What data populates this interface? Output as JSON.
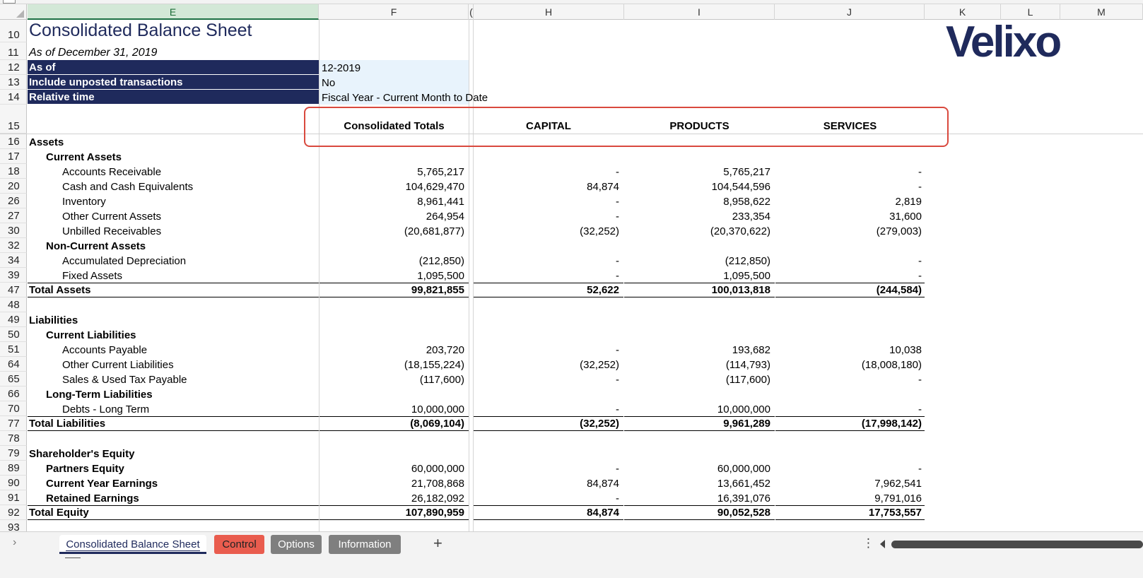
{
  "columns": [
    {
      "id": "E",
      "label": "E"
    },
    {
      "id": "F",
      "label": "F"
    },
    {
      "id": "G",
      "label": "("
    },
    {
      "id": "H",
      "label": "H"
    },
    {
      "id": "I",
      "label": "I"
    },
    {
      "id": "J",
      "label": "J"
    },
    {
      "id": "K",
      "label": "K"
    },
    {
      "id": "L",
      "label": "L"
    },
    {
      "id": "M",
      "label": "M"
    }
  ],
  "logo": "Velixo",
  "report": {
    "title": "Consolidated Balance Sheet",
    "subtitle": "As of December 31, 2019"
  },
  "params": [
    {
      "row": "12",
      "label": "As of",
      "value": "12-2019"
    },
    {
      "row": "13",
      "label": "Include unposted transactions",
      "value": "No"
    },
    {
      "row": "14",
      "label": "Relative time",
      "value": "Fiscal Year - Current Month to Date"
    }
  ],
  "header": {
    "row": "15",
    "consolidated": "Consolidated Totals",
    "capital": "CAPITAL",
    "products": "PRODUCTS",
    "services": "SERVICES"
  },
  "rows": [
    {
      "row": "16",
      "label": "Assets",
      "level": 0,
      "bold": true,
      "total": false,
      "f": "",
      "h": "",
      "i": "",
      "j": ""
    },
    {
      "row": "17",
      "label": "Current Assets",
      "level": 1,
      "bold": true,
      "total": false,
      "f": "",
      "h": "",
      "i": "",
      "j": ""
    },
    {
      "row": "18",
      "label": "Accounts Receivable",
      "level": 2,
      "bold": false,
      "total": false,
      "f": "5,765,217",
      "h": "-",
      "i": "5,765,217",
      "j": "-"
    },
    {
      "row": "20",
      "label": "Cash and Cash Equivalents",
      "level": 2,
      "bold": false,
      "total": false,
      "f": "104,629,470",
      "h": "84,874",
      "i": "104,544,596",
      "j": "-"
    },
    {
      "row": "26",
      "label": "Inventory",
      "level": 2,
      "bold": false,
      "total": false,
      "f": "8,961,441",
      "h": "-",
      "i": "8,958,622",
      "j": "2,819"
    },
    {
      "row": "27",
      "label": "Other Current Assets",
      "level": 2,
      "bold": false,
      "total": false,
      "f": "264,954",
      "h": "-",
      "i": "233,354",
      "j": "31,600"
    },
    {
      "row": "30",
      "label": "Unbilled Receivables",
      "level": 2,
      "bold": false,
      "total": false,
      "f": "(20,681,877)",
      "h": "(32,252)",
      "i": "(20,370,622)",
      "j": "(279,003)"
    },
    {
      "row": "32",
      "label": "Non-Current Assets",
      "level": 1,
      "bold": true,
      "total": false,
      "f": "",
      "h": "",
      "i": "",
      "j": ""
    },
    {
      "row": "34",
      "label": "Accumulated Depreciation",
      "level": 2,
      "bold": false,
      "total": false,
      "f": "(212,850)",
      "h": "-",
      "i": "(212,850)",
      "j": "-"
    },
    {
      "row": "39",
      "label": "Fixed Assets",
      "level": 2,
      "bold": false,
      "total": false,
      "f": "1,095,500",
      "h": "-",
      "i": "1,095,500",
      "j": "-"
    },
    {
      "row": "47",
      "label": "Total Assets",
      "level": 0,
      "bold": true,
      "total": true,
      "f": "99,821,855",
      "h": "52,622",
      "i": "100,013,818",
      "j": "(244,584)"
    },
    {
      "row": "48",
      "label": "",
      "level": 0,
      "bold": false,
      "total": false,
      "f": "",
      "h": "",
      "i": "",
      "j": ""
    },
    {
      "row": "49",
      "label": "Liabilities",
      "level": 0,
      "bold": true,
      "total": false,
      "f": "",
      "h": "",
      "i": "",
      "j": ""
    },
    {
      "row": "50",
      "label": "Current Liabilities",
      "level": 1,
      "bold": true,
      "total": false,
      "f": "",
      "h": "",
      "i": "",
      "j": ""
    },
    {
      "row": "51",
      "label": "Accounts Payable",
      "level": 2,
      "bold": false,
      "total": false,
      "f": "203,720",
      "h": "-",
      "i": "193,682",
      "j": "10,038"
    },
    {
      "row": "64",
      "label": "Other Current Liabilities",
      "level": 2,
      "bold": false,
      "total": false,
      "f": "(18,155,224)",
      "h": "(32,252)",
      "i": "(114,793)",
      "j": "(18,008,180)"
    },
    {
      "row": "65",
      "label": "Sales & Used Tax Payable",
      "level": 2,
      "bold": false,
      "total": false,
      "f": "(117,600)",
      "h": "-",
      "i": "(117,600)",
      "j": "-"
    },
    {
      "row": "66",
      "label": "Long-Term Liabilities",
      "level": 1,
      "bold": true,
      "total": false,
      "f": "",
      "h": "",
      "i": "",
      "j": ""
    },
    {
      "row": "70",
      "label": "Debts - Long Term",
      "level": 2,
      "bold": false,
      "total": false,
      "f": "10,000,000",
      "h": "-",
      "i": "10,000,000",
      "j": "-"
    },
    {
      "row": "77",
      "label": "Total Liabilities",
      "level": 0,
      "bold": true,
      "total": true,
      "f": "(8,069,104)",
      "h": "(32,252)",
      "i": "9,961,289",
      "j": "(17,998,142)"
    },
    {
      "row": "78",
      "label": "",
      "level": 0,
      "bold": false,
      "total": false,
      "f": "",
      "h": "",
      "i": "",
      "j": ""
    },
    {
      "row": "79",
      "label": "Shareholder's Equity",
      "level": 0,
      "bold": true,
      "total": false,
      "f": "",
      "h": "",
      "i": "",
      "j": ""
    },
    {
      "row": "89",
      "label": "Partners Equity",
      "level": 1,
      "bold": true,
      "total": false,
      "f": "60,000,000",
      "h": "-",
      "i": "60,000,000",
      "j": "-"
    },
    {
      "row": "90",
      "label": "Current Year Earnings",
      "level": 1,
      "bold": true,
      "total": false,
      "f": "21,708,868",
      "h": "84,874",
      "i": "13,661,452",
      "j": "7,962,541"
    },
    {
      "row": "91",
      "label": "Retained Earnings",
      "level": 1,
      "bold": true,
      "total": false,
      "f": "26,182,092",
      "h": "-",
      "i": "16,391,076",
      "j": "9,791,016"
    },
    {
      "row": "92",
      "label": "Total Equity",
      "level": 0,
      "bold": true,
      "total": true,
      "f": "107,890,959",
      "h": "84,874",
      "i": "90,052,528",
      "j": "17,753,557"
    },
    {
      "row": "93",
      "label": "",
      "level": 0,
      "bold": false,
      "total": false,
      "f": "",
      "h": "",
      "i": "",
      "j": ""
    }
  ],
  "tabs": {
    "nav": "›",
    "active": "Consolidated Balance Sheet",
    "control": "Control",
    "options": "Options",
    "information": "Information",
    "add": "+",
    "more": "⋮"
  },
  "colors": {
    "navy": "#1f2a5c",
    "param_fill": "#e8f3fc",
    "control_tab": "#e95c4e",
    "grey_tab": "#7f7f7f",
    "highlight": "#d9493e"
  }
}
